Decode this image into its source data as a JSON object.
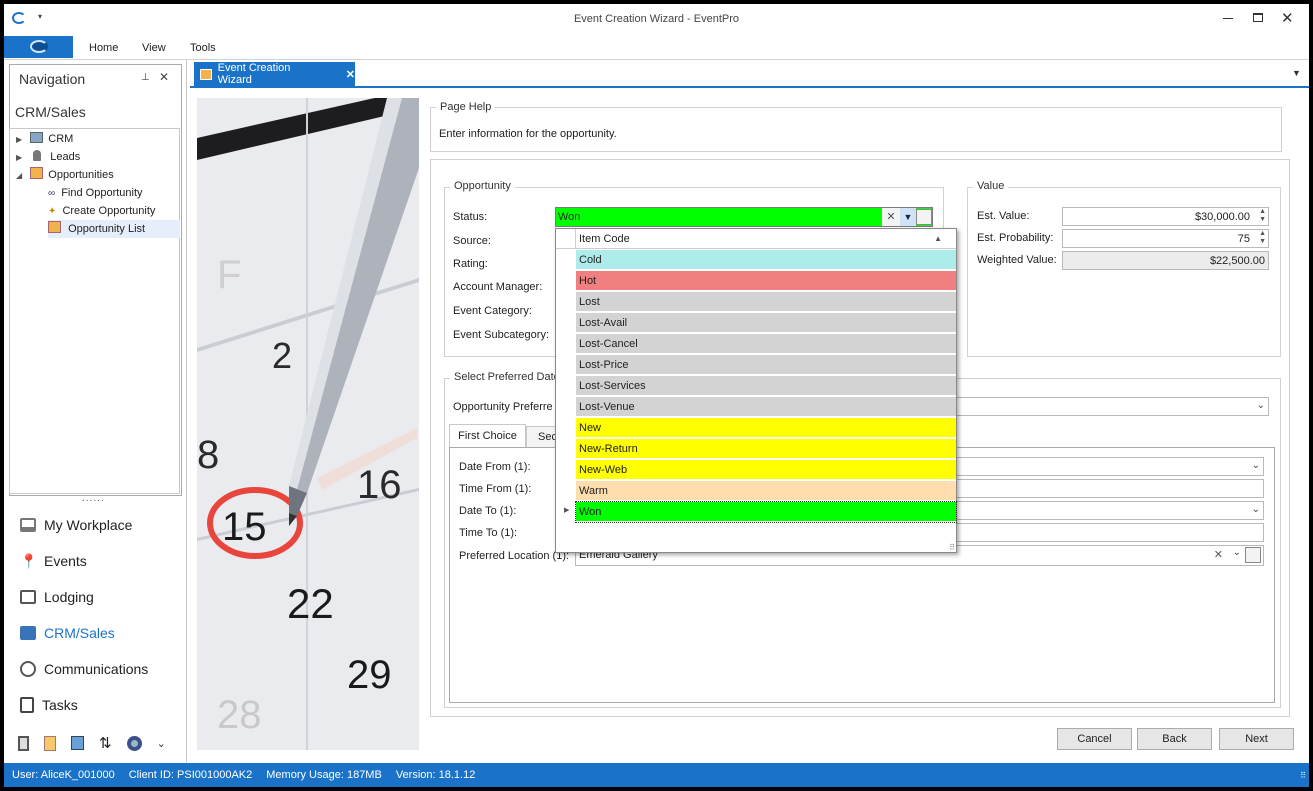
{
  "window": {
    "title": "Event Creation Wizard - EventPro"
  },
  "ribbon": {
    "tabs": [
      "Home",
      "View",
      "Tools"
    ]
  },
  "navigation": {
    "title": "Navigation",
    "section": "CRM/Sales",
    "tree": [
      {
        "label": "CRM",
        "icon": "crm-icon"
      },
      {
        "label": "Leads",
        "icon": "person-icon"
      },
      {
        "label": "Opportunities",
        "icon": "folder-icon"
      },
      {
        "label": "Find Opportunity",
        "icon": "binoculars-icon"
      },
      {
        "label": "Create Opportunity",
        "icon": "wand-icon"
      },
      {
        "label": "Opportunity List",
        "icon": "list-icon"
      }
    ],
    "splitter": "......",
    "buttons": [
      "My Workplace",
      "Events",
      "Lodging",
      "CRM/Sales",
      "Communications",
      "Tasks"
    ],
    "active_color": "#1a73c9"
  },
  "document_tab": {
    "label": "Event Creation Wizard"
  },
  "page_help": {
    "title": "Page Help",
    "text": "Enter information for the opportunity."
  },
  "opportunity": {
    "title": "Opportunity",
    "labels": {
      "status": "Status:",
      "source": "Source:",
      "rating": "Rating:",
      "account_manager": "Account Manager:",
      "event_category": "Event Category:",
      "event_subcategory": "Event Subcategory:"
    },
    "status_value": "Won",
    "status_color": "#00ff00"
  },
  "value": {
    "title": "Value",
    "est_value_label": "Est. Value:",
    "est_value": "$30,000.00",
    "est_probability_label": "Est. Probability:",
    "est_probability": "75",
    "weighted_value_label": "Weighted Value:",
    "weighted_value": "$22,500.00"
  },
  "preferred_dates": {
    "title": "Select Preferred Date",
    "opportunity_preferred_label": "Opportunity Preferre",
    "tabs": [
      "First Choice",
      "Sec"
    ],
    "labels": {
      "date_from": "Date From (1):",
      "time_from": "Time From (1):",
      "date_to": "Date To (1):",
      "time_to": "Time To (1):",
      "preferred_location": "Preferred Location (1):"
    },
    "preferred_location_value": "Emerald Gallery"
  },
  "status_dropdown": {
    "column_header": "Item Code",
    "selected": "Won",
    "items": [
      {
        "label": "Cold",
        "color": "#aeecec"
      },
      {
        "label": "Hot",
        "color": "#f08080"
      },
      {
        "label": "Lost",
        "color": "#d3d3d3"
      },
      {
        "label": "Lost-Avail",
        "color": "#d3d3d3"
      },
      {
        "label": "Lost-Cancel",
        "color": "#d3d3d3"
      },
      {
        "label": "Lost-Price",
        "color": "#d3d3d3"
      },
      {
        "label": "Lost-Services",
        "color": "#d3d3d3"
      },
      {
        "label": "Lost-Venue",
        "color": "#d3d3d3"
      },
      {
        "label": "New",
        "color": "#ffff00"
      },
      {
        "label": "New-Return",
        "color": "#ffff00"
      },
      {
        "label": "New-Web",
        "color": "#ffff00"
      },
      {
        "label": "Warm",
        "color": "#ffdead"
      },
      {
        "label": "Won",
        "color": "#00ff00"
      }
    ]
  },
  "buttons": {
    "cancel": "Cancel",
    "back": "Back",
    "next": "Next"
  },
  "statusbar": {
    "user": "User: AliceK_001000",
    "client": "Client ID: PSI001000AK2",
    "memory": "Memory Usage: 187MB",
    "version": "Version: 18.1.12"
  }
}
